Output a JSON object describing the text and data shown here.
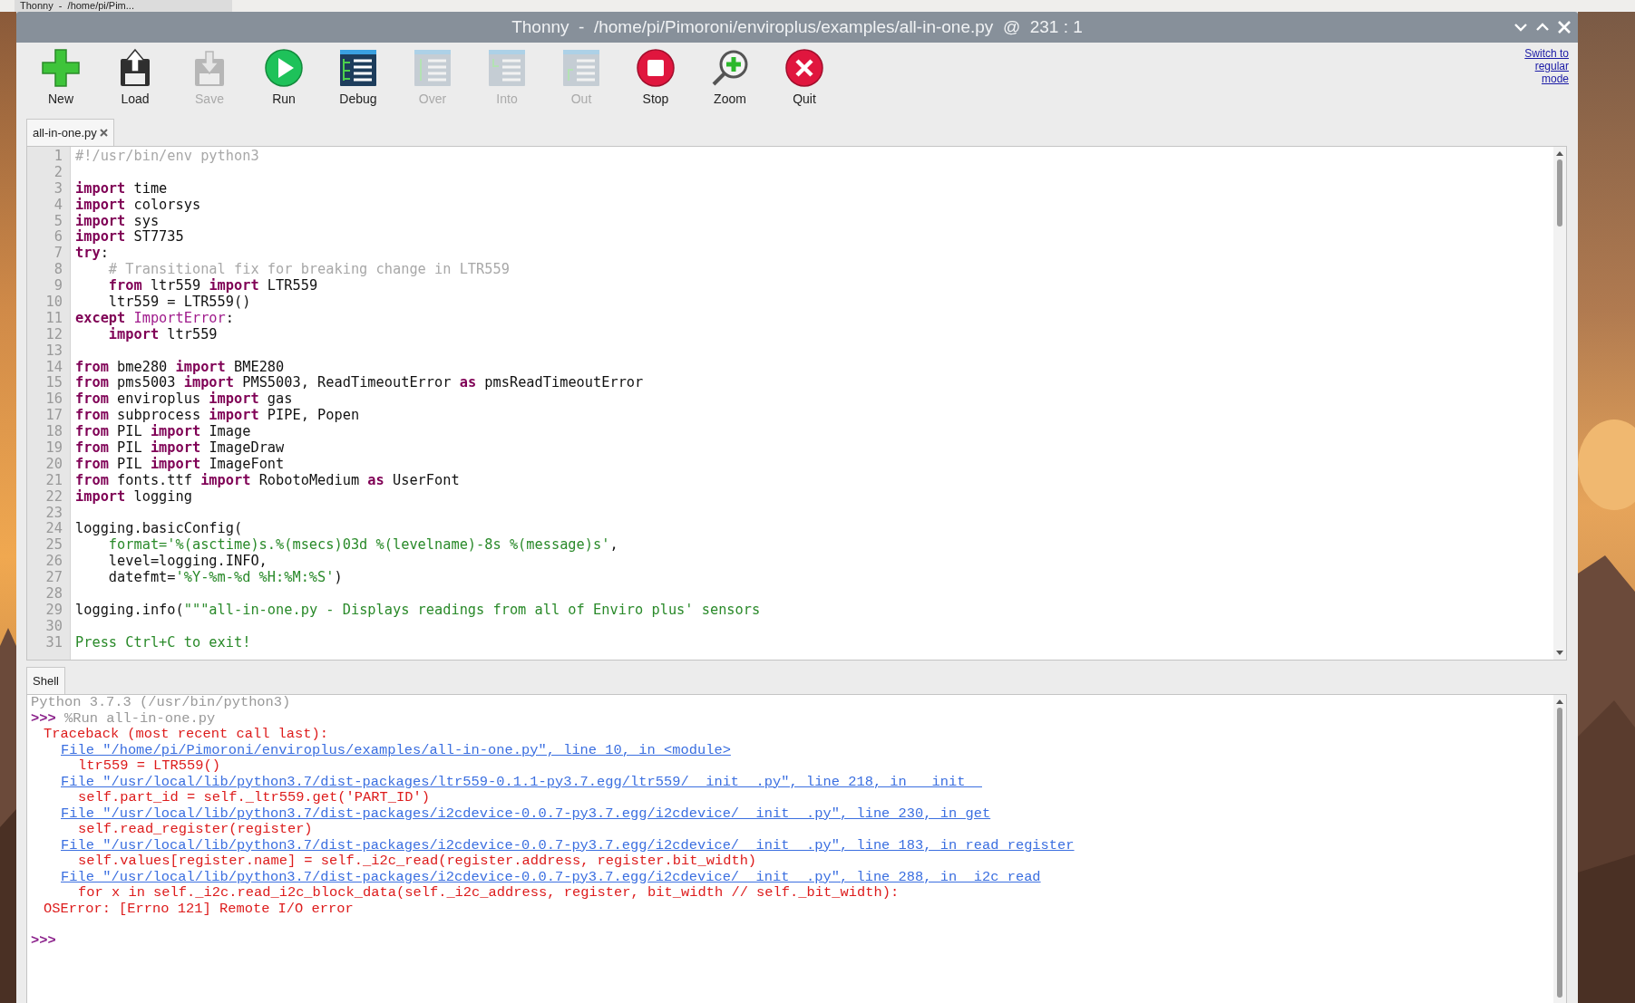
{
  "taskbar": {
    "window_button": "Thonny  -  /home/pi/Pim..."
  },
  "window": {
    "title": "Thonny  -  /home/pi/Pimoroni/enviroplus/examples/all-in-one.py  @  231 : 1"
  },
  "toolbar": [
    {
      "kind": "new",
      "label": "New",
      "disabled": false
    },
    {
      "kind": "load",
      "label": "Load",
      "disabled": false
    },
    {
      "kind": "save",
      "label": "Save",
      "disabled": true
    },
    {
      "kind": "run",
      "label": "Run",
      "disabled": false
    },
    {
      "kind": "debug",
      "label": "Debug",
      "disabled": false
    },
    {
      "kind": "over",
      "label": "Over",
      "disabled": true
    },
    {
      "kind": "into",
      "label": "Into",
      "disabled": true
    },
    {
      "kind": "out",
      "label": "Out",
      "disabled": true
    },
    {
      "kind": "stop",
      "label": "Stop",
      "disabled": false
    },
    {
      "kind": "zoom",
      "label": "Zoom",
      "disabled": false
    },
    {
      "kind": "quit",
      "label": "Quit",
      "disabled": false
    }
  ],
  "mode_link": "Switch to regular mode",
  "editor": {
    "tabs": [
      {
        "label": "all-in-one.py",
        "selected": true
      }
    ],
    "lines": [
      {
        "number": "1",
        "tokens": [
          {
            "kind": "comment",
            "text": "#!/usr/bin/env python3"
          }
        ]
      },
      {
        "number": "2"
      },
      {
        "number": "3",
        "tokens": [
          {
            "kind": "keyword",
            "text": "import"
          },
          {
            "kind": "plain",
            "text": " time"
          }
        ]
      },
      {
        "number": "4",
        "tokens": [
          {
            "kind": "keyword",
            "text": "import"
          },
          {
            "kind": "plain",
            "text": " colorsys"
          }
        ]
      },
      {
        "number": "5",
        "tokens": [
          {
            "kind": "keyword",
            "text": "import"
          },
          {
            "kind": "plain",
            "text": " sys"
          }
        ]
      },
      {
        "number": "6",
        "tokens": [
          {
            "kind": "keyword",
            "text": "import"
          },
          {
            "kind": "plain",
            "text": " ST7735"
          }
        ]
      },
      {
        "number": "7",
        "tokens": [
          {
            "kind": "keyword",
            "text": "try"
          },
          {
            "kind": "plain",
            "text": ":"
          }
        ]
      },
      {
        "number": "8",
        "tokens": [
          {
            "kind": "comment",
            "text": "    # Transitional fix for breaking change in LTR559"
          }
        ]
      },
      {
        "number": "9",
        "tokens": [
          {
            "kind": "keyword",
            "text": "    from"
          },
          {
            "kind": "plain",
            "text": " ltr559 "
          },
          {
            "kind": "keyword",
            "text": "import"
          },
          {
            "kind": "plain",
            "text": " LTR559"
          }
        ]
      },
      {
        "number": "10",
        "tokens": [
          {
            "kind": "plain",
            "text": "    ltr559 = LTR559()"
          }
        ]
      },
      {
        "number": "11",
        "tokens": [
          {
            "kind": "keyword",
            "text": "except"
          },
          {
            "kind": "builtin",
            "text": " ImportError"
          },
          {
            "kind": "plain",
            "text": ":"
          }
        ]
      },
      {
        "number": "12",
        "tokens": [
          {
            "kind": "keyword",
            "text": "    import"
          },
          {
            "kind": "plain",
            "text": " ltr559"
          }
        ]
      },
      {
        "number": "13"
      },
      {
        "number": "14",
        "tokens": [
          {
            "kind": "keyword",
            "text": "from"
          },
          {
            "kind": "plain",
            "text": " bme280 "
          },
          {
            "kind": "keyword",
            "text": "import"
          },
          {
            "kind": "plain",
            "text": " BME280"
          }
        ]
      },
      {
        "number": "15",
        "tokens": [
          {
            "kind": "keyword",
            "text": "from"
          },
          {
            "kind": "plain",
            "text": " pms5003 "
          },
          {
            "kind": "keyword",
            "text": "import"
          },
          {
            "kind": "plain",
            "text": " PMS5003, ReadTimeoutError "
          },
          {
            "kind": "keyword",
            "text": "as"
          },
          {
            "kind": "plain",
            "text": " pmsReadTimeoutError"
          }
        ]
      },
      {
        "number": "16",
        "tokens": [
          {
            "kind": "keyword",
            "text": "from"
          },
          {
            "kind": "plain",
            "text": " enviroplus "
          },
          {
            "kind": "keyword",
            "text": "import"
          },
          {
            "kind": "plain",
            "text": " gas"
          }
        ]
      },
      {
        "number": "17",
        "tokens": [
          {
            "kind": "keyword",
            "text": "from"
          },
          {
            "kind": "plain",
            "text": " subprocess "
          },
          {
            "kind": "keyword",
            "text": "import"
          },
          {
            "kind": "plain",
            "text": " PIPE, Popen"
          }
        ]
      },
      {
        "number": "18",
        "tokens": [
          {
            "kind": "keyword",
            "text": "from"
          },
          {
            "kind": "plain",
            "text": " PIL "
          },
          {
            "kind": "keyword",
            "text": "import"
          },
          {
            "kind": "plain",
            "text": " Image"
          }
        ]
      },
      {
        "number": "19",
        "tokens": [
          {
            "kind": "keyword",
            "text": "from"
          },
          {
            "kind": "plain",
            "text": " PIL "
          },
          {
            "kind": "keyword",
            "text": "import"
          },
          {
            "kind": "plain",
            "text": " ImageDraw"
          }
        ]
      },
      {
        "number": "20",
        "tokens": [
          {
            "kind": "keyword",
            "text": "from"
          },
          {
            "kind": "plain",
            "text": " PIL "
          },
          {
            "kind": "keyword",
            "text": "import"
          },
          {
            "kind": "plain",
            "text": " ImageFont"
          }
        ]
      },
      {
        "number": "21",
        "tokens": [
          {
            "kind": "keyword",
            "text": "from"
          },
          {
            "kind": "plain",
            "text": " fonts.ttf "
          },
          {
            "kind": "keyword",
            "text": "import"
          },
          {
            "kind": "plain",
            "text": " RobotoMedium "
          },
          {
            "kind": "keyword",
            "text": "as"
          },
          {
            "kind": "plain",
            "text": " UserFont"
          }
        ]
      },
      {
        "number": "22",
        "tokens": [
          {
            "kind": "keyword",
            "text": "import"
          },
          {
            "kind": "plain",
            "text": " logging"
          }
        ]
      },
      {
        "number": "23"
      },
      {
        "number": "24",
        "tokens": [
          {
            "kind": "plain",
            "text": "logging.basicConfig("
          }
        ]
      },
      {
        "number": "25",
        "tokens": [
          {
            "kind": "string",
            "text": "    format='%(asctime)s.%(msecs)03d %(levelname)-8s %(message)s'"
          },
          {
            "kind": "plain",
            "text": ","
          }
        ]
      },
      {
        "number": "26",
        "tokens": [
          {
            "kind": "plain",
            "text": "    level=logging.INFO,"
          }
        ]
      },
      {
        "number": "27",
        "tokens": [
          {
            "kind": "plain",
            "text": "    datefmt="
          },
          {
            "kind": "string",
            "text": "'%Y-%m-%d %H:%M:%S'"
          },
          {
            "kind": "plain",
            "text": ")"
          }
        ]
      },
      {
        "number": "28"
      },
      {
        "number": "29",
        "tokens": [
          {
            "kind": "plain",
            "text": "logging.info("
          },
          {
            "kind": "string",
            "text": "\"\"\"all-in-one.py - Displays readings from all of Enviro plus' sensors"
          }
        ]
      },
      {
        "number": "30"
      },
      {
        "number": "31",
        "tokens": [
          {
            "kind": "string",
            "text": "Press Ctrl+C to exit!"
          }
        ]
      }
    ]
  },
  "shell": {
    "tabs": [
      {
        "label": "Shell",
        "selected": true
      }
    ],
    "lines": [
      {
        "kind": "info",
        "text": "Python 3.7.3 (/usr/bin/python3)"
      },
      {
        "kind": "prompt",
        "prompt": ">>>",
        "command": "%Run all-in-one.py"
      },
      {
        "kind": "traceback",
        "text": "Traceback (most recent call last):"
      },
      {
        "kind": "link",
        "text": "File \"/home/pi/Pimoroni/enviroplus/examples/all-in-one.py\", line 10, in <module>"
      },
      {
        "kind": "source",
        "text": "ltr559 = LTR559()"
      },
      {
        "kind": "link",
        "text": "File \"/usr/local/lib/python3.7/dist-packages/ltr559-0.1.1-py3.7.egg/ltr559/__init__.py\", line 218, in __init__"
      },
      {
        "kind": "source",
        "text": "self.part_id = self._ltr559.get('PART_ID')"
      },
      {
        "kind": "link",
        "text": "File \"/usr/local/lib/python3.7/dist-packages/i2cdevice-0.0.7-py3.7.egg/i2cdevice/__init__.py\", line 230, in get"
      },
      {
        "kind": "source",
        "text": "self.read_register(register)"
      },
      {
        "kind": "link",
        "text": "File \"/usr/local/lib/python3.7/dist-packages/i2cdevice-0.0.7-py3.7.egg/i2cdevice/__init__.py\", line 183, in read_register"
      },
      {
        "kind": "source",
        "text": "self.values[register.name] = self._i2c_read(register.address, register.bit_width)"
      },
      {
        "kind": "link",
        "text": "File \"/usr/local/lib/python3.7/dist-packages/i2cdevice-0.0.7-py3.7.egg/i2cdevice/__init__.py\", line 288, in _i2c_read"
      },
      {
        "kind": "source",
        "text": "for x in self._i2c.read_i2c_block_data(self._i2c_address, register, bit_width // self._bit_width):"
      },
      {
        "kind": "error",
        "text": "OSError: [Errno 121] Remote I/O error"
      },
      {
        "kind": "blank"
      },
      {
        "kind": "prompt",
        "prompt": ">>>"
      }
    ]
  }
}
